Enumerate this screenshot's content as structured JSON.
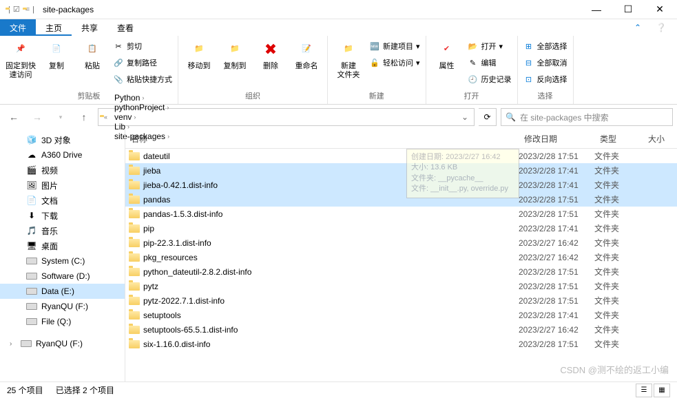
{
  "window": {
    "title": "site-packages"
  },
  "tabs": {
    "file": "文件",
    "home": "主页",
    "share": "共享",
    "view": "查看"
  },
  "ribbon": {
    "clipboard": {
      "label": "剪贴板",
      "pin": "固定到快\n速访问",
      "copy": "复制",
      "paste": "粘贴",
      "cut": "剪切",
      "copypath": "复制路径",
      "pasteshortcut": "粘贴快捷方式"
    },
    "organize": {
      "label": "组织",
      "moveto": "移动到",
      "copyto": "复制到",
      "delete": "删除",
      "rename": "重命名"
    },
    "new": {
      "label": "新建",
      "newfolder": "新建\n文件夹",
      "newitem": "新建项目",
      "easyaccess": "轻松访问"
    },
    "open": {
      "label": "打开",
      "properties": "属性",
      "open": "打开",
      "edit": "编辑",
      "history": "历史记录"
    },
    "select": {
      "label": "选择",
      "selectall": "全部选择",
      "selectnone": "全部取消",
      "invert": "反向选择"
    }
  },
  "breadcrumbs": [
    "Python",
    "pythonProject",
    "venv",
    "Lib",
    "site-packages"
  ],
  "search": {
    "placeholder": "在 site-packages 中搜索"
  },
  "sidebar": [
    {
      "name": "3D 对象",
      "icon": "3d"
    },
    {
      "name": "A360 Drive",
      "icon": "a360"
    },
    {
      "name": "视频",
      "icon": "video"
    },
    {
      "name": "图片",
      "icon": "pic"
    },
    {
      "name": "文档",
      "icon": "doc"
    },
    {
      "name": "下载",
      "icon": "down"
    },
    {
      "name": "音乐",
      "icon": "music"
    },
    {
      "name": "桌面",
      "icon": "desk"
    },
    {
      "name": "System (C:)",
      "icon": "drive"
    },
    {
      "name": "Software (D:)",
      "icon": "drive"
    },
    {
      "name": "Data (E:)",
      "icon": "drive",
      "sel": true
    },
    {
      "name": "RyanQU (F:)",
      "icon": "drive"
    },
    {
      "name": "File (Q:)",
      "icon": "drive"
    }
  ],
  "sidebar_bottom": {
    "name": "RyanQU (F:)",
    "icon": "drive"
  },
  "columns": {
    "name": "名称",
    "date": "修改日期",
    "type": "类型",
    "size": "大小"
  },
  "rows": [
    {
      "name": "dateutil",
      "date": "2023/2/28 17:51",
      "type": "文件夹",
      "sel": false
    },
    {
      "name": "jieba",
      "date": "2023/2/28 17:41",
      "type": "文件夹",
      "sel": true
    },
    {
      "name": "jieba-0.42.1.dist-info",
      "date": "2023/2/28 17:41",
      "type": "文件夹",
      "sel": true
    },
    {
      "name": "pandas",
      "date": "2023/2/28 17:51",
      "type": "文件夹",
      "sel": true
    },
    {
      "name": "pandas-1.5.3.dist-info",
      "date": "2023/2/28 17:51",
      "type": "文件夹",
      "sel": false
    },
    {
      "name": "pip",
      "date": "2023/2/28 17:41",
      "type": "文件夹",
      "sel": false
    },
    {
      "name": "pip-22.3.1.dist-info",
      "date": "2023/2/27 16:42",
      "type": "文件夹",
      "sel": false
    },
    {
      "name": "pkg_resources",
      "date": "2023/2/27 16:42",
      "type": "文件夹",
      "sel": false
    },
    {
      "name": "python_dateutil-2.8.2.dist-info",
      "date": "2023/2/28 17:51",
      "type": "文件夹",
      "sel": false
    },
    {
      "name": "pytz",
      "date": "2023/2/28 17:51",
      "type": "文件夹",
      "sel": false
    },
    {
      "name": "pytz-2022.7.1.dist-info",
      "date": "2023/2/28 17:51",
      "type": "文件夹",
      "sel": false
    },
    {
      "name": "setuptools",
      "date": "2023/2/28 17:41",
      "type": "文件夹",
      "sel": false
    },
    {
      "name": "setuptools-65.5.1.dist-info",
      "date": "2023/2/27 16:42",
      "type": "文件夹",
      "sel": false
    },
    {
      "name": "six-1.16.0.dist-info",
      "date": "2023/2/28 17:51",
      "type": "文件夹",
      "sel": false
    }
  ],
  "tooltip": {
    "l1": "创建日期: 2023/2/27 16:42",
    "l2": "大小: 13.6 KB",
    "l3": "文件夹: __pycache__",
    "l4": "文件: __init__.py, override.py"
  },
  "status": {
    "count": "25 个项目",
    "selected": "已选择 2 个项目"
  },
  "watermark": "CSDN @测不绘的返工小编"
}
